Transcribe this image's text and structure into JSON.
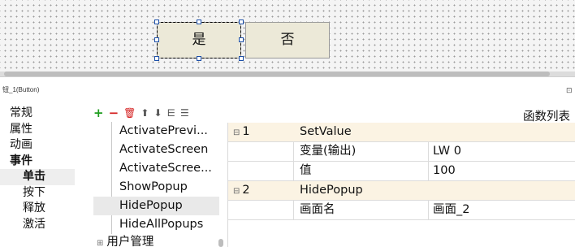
{
  "canvas": {
    "button_yes_label": "是",
    "button_no_label": "否"
  },
  "panel": {
    "title": "钮_1(Button)",
    "pin_icon": "pin-icon"
  },
  "categories": [
    {
      "label": "常规",
      "bold": false,
      "sub": false,
      "active": false
    },
    {
      "label": "属性",
      "bold": false,
      "sub": false,
      "active": false
    },
    {
      "label": "动画",
      "bold": false,
      "sub": false,
      "active": false
    },
    {
      "label": "事件",
      "bold": true,
      "sub": false,
      "active": false
    },
    {
      "label": "单击",
      "bold": true,
      "sub": true,
      "active": true
    },
    {
      "label": "按下",
      "bold": false,
      "sub": true,
      "active": false
    },
    {
      "label": "释放",
      "bold": false,
      "sub": true,
      "active": false
    },
    {
      "label": "激活",
      "bold": false,
      "sub": true,
      "active": false
    }
  ],
  "toolbar": {
    "add": "+",
    "remove": "−",
    "delete": "🗑",
    "move_up": "⬆",
    "move_down": "⬇",
    "icon_a": "⋿",
    "icon_b": "☰"
  },
  "functions": [
    "ActivatePrevi...",
    "ActivateScreen",
    "ActivateScree...",
    "ShowPopup",
    "HidePopup",
    "HideAllPopups"
  ],
  "selected_function_index": 4,
  "function_group": {
    "expander": "⊞",
    "label": "用户管理"
  },
  "function_list_title": "函数列表",
  "table": {
    "groups": [
      {
        "index": "1",
        "name": "SetValue",
        "params": [
          {
            "name": "变量(输出)",
            "value": "LW 0"
          },
          {
            "name": "值",
            "value": "100"
          }
        ]
      },
      {
        "index": "2",
        "name": "HidePopup",
        "params": [
          {
            "name": "画面名",
            "value": "画面_2"
          }
        ]
      }
    ],
    "collapse_glyph": "⊟"
  },
  "colors": {
    "header_row": "#fbf3e3",
    "button_face": "#ece9d8",
    "selection_handle": "#1c4fa8"
  }
}
